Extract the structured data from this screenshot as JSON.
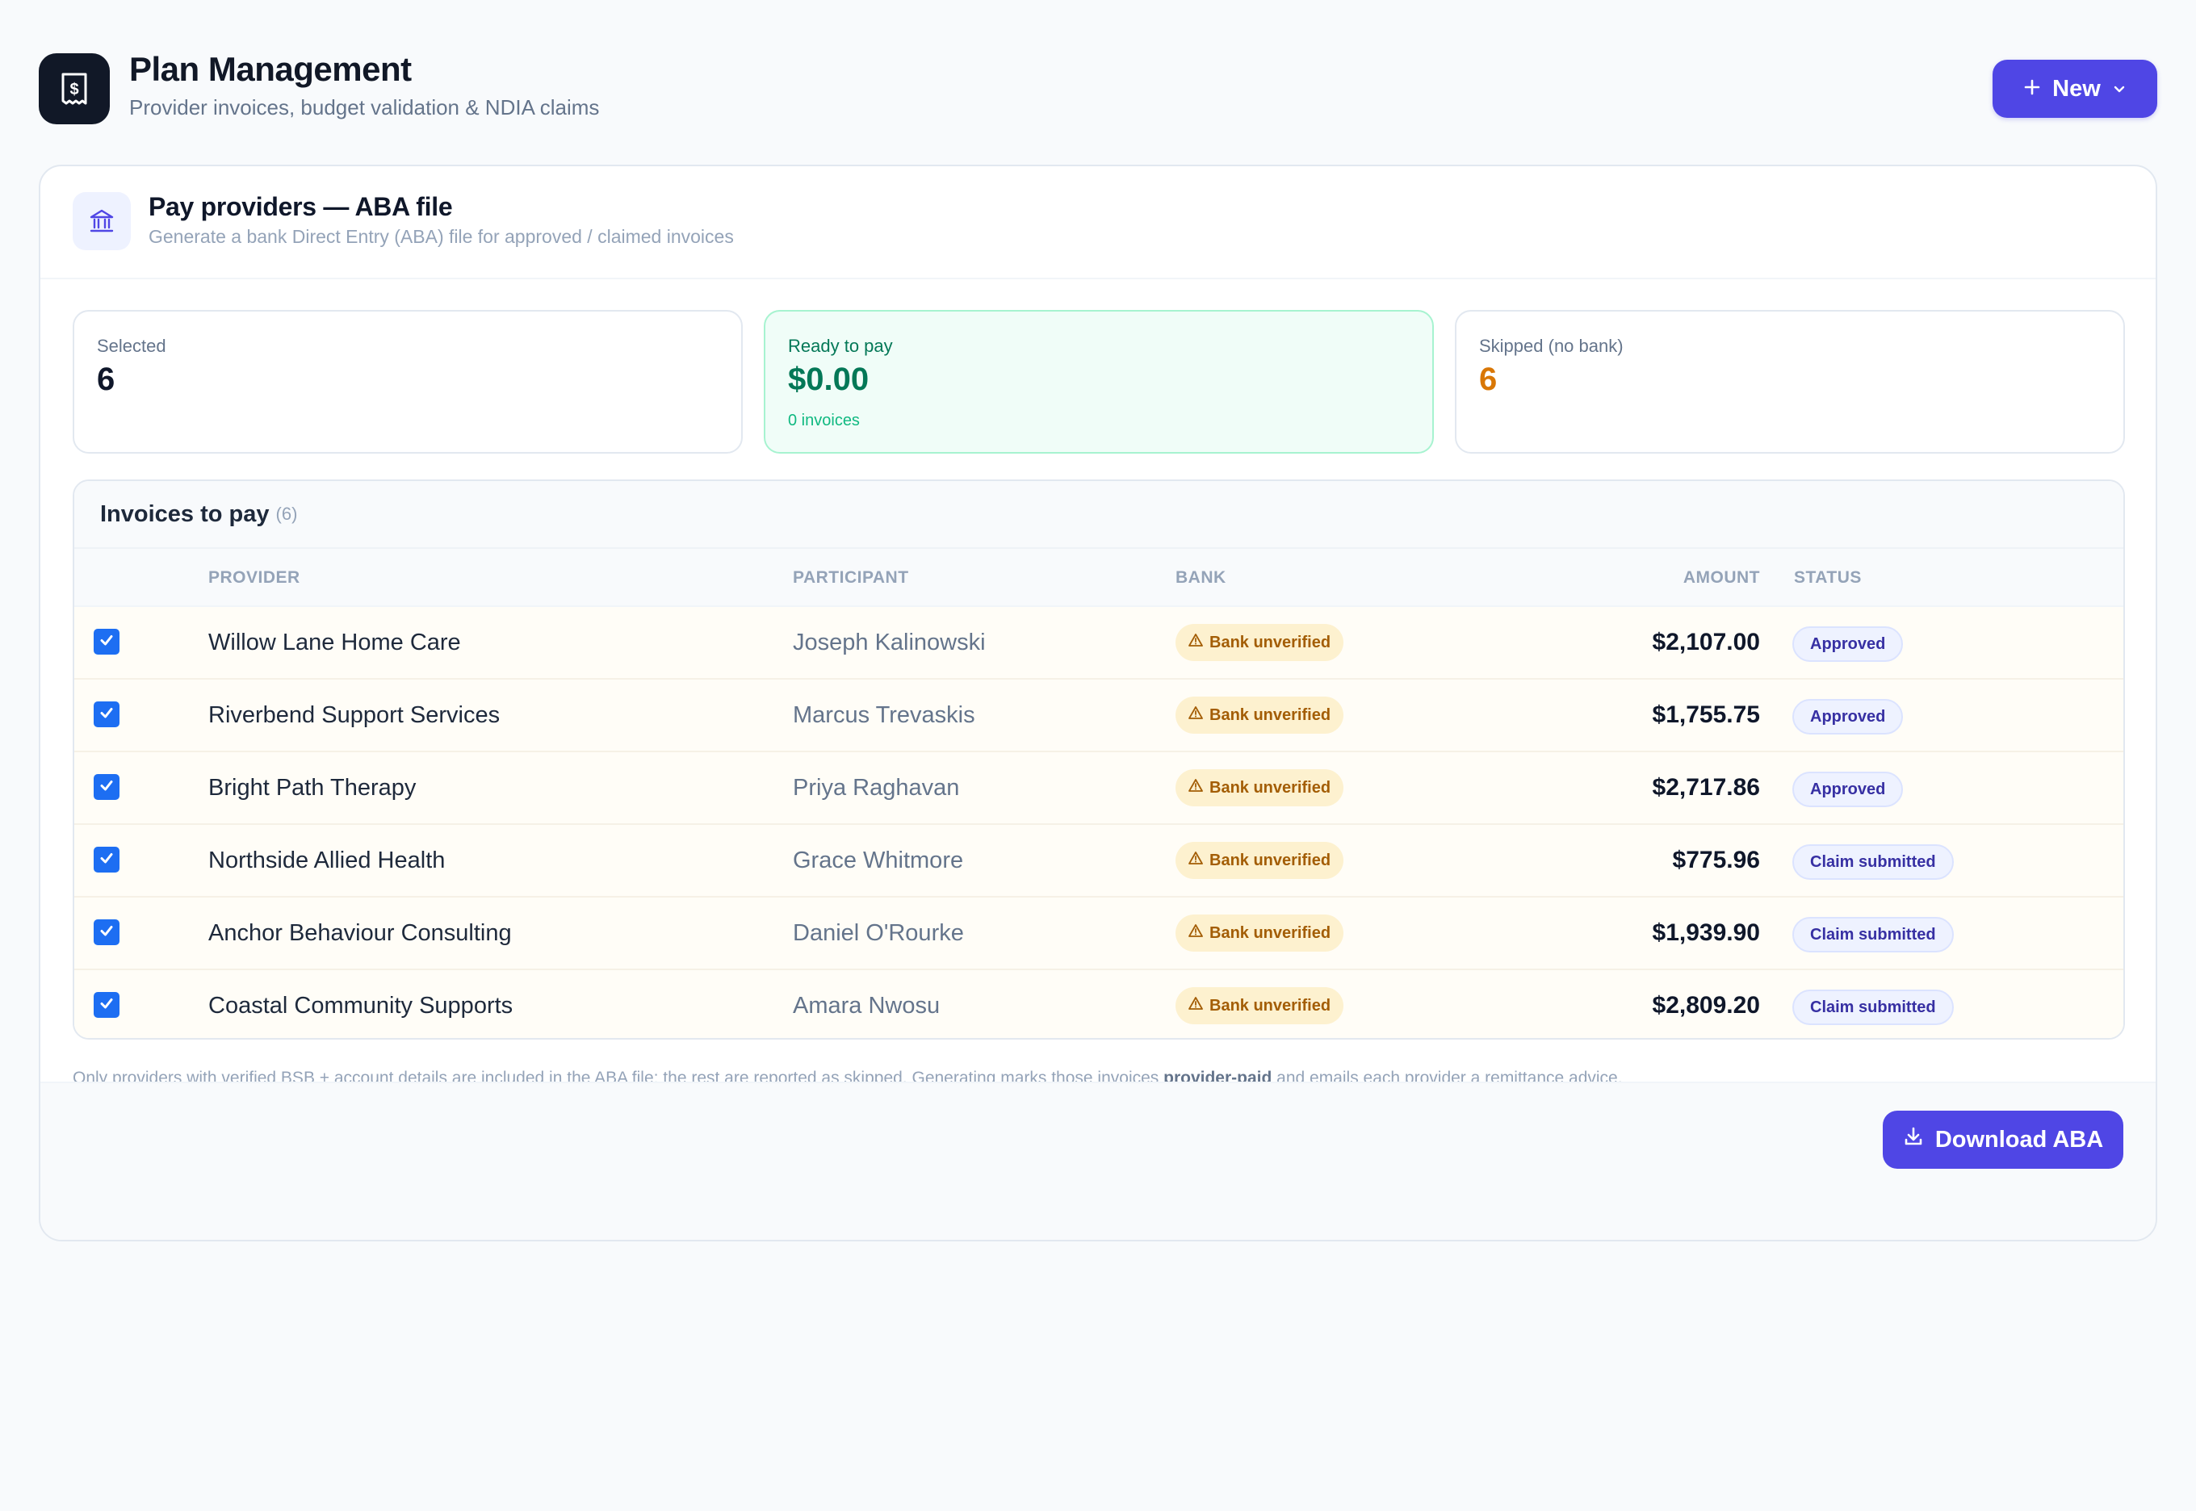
{
  "header": {
    "title": "Plan Management",
    "subtitle": "Provider invoices, budget validation & NDIA claims",
    "new_label": "New"
  },
  "card": {
    "title": "Pay providers — ABA file",
    "subtitle": "Generate a bank Direct Entry (ABA) file for approved / claimed invoices"
  },
  "stats": {
    "selected_label": "Selected",
    "selected_value": "6",
    "ready_label": "Ready to pay",
    "ready_value": "$0.00",
    "ready_sub": "0 invoices",
    "skipped_label": "Skipped (no bank)",
    "skipped_value": "6"
  },
  "invoices": {
    "title": "Invoices to pay",
    "count": "(6)",
    "columns": {
      "provider": "PROVIDER",
      "participant": "PARTICIPANT",
      "bank": "BANK",
      "amount": "AMOUNT",
      "status": "STATUS"
    },
    "rows": [
      {
        "provider": "Willow Lane Home Care",
        "participant": "Joseph Kalinowski",
        "bank": "Bank unverified",
        "amount": "$2,107.00",
        "status": "Approved",
        "checked": true
      },
      {
        "provider": "Riverbend Support Services",
        "participant": "Marcus Trevaskis",
        "bank": "Bank unverified",
        "amount": "$1,755.75",
        "status": "Approved",
        "checked": true
      },
      {
        "provider": "Bright Path Therapy",
        "participant": "Priya Raghavan",
        "bank": "Bank unverified",
        "amount": "$2,717.86",
        "status": "Approved",
        "checked": true
      },
      {
        "provider": "Northside Allied Health",
        "participant": "Grace Whitmore",
        "bank": "Bank unverified",
        "amount": "$775.96",
        "status": "Claim submitted",
        "checked": true
      },
      {
        "provider": "Anchor Behaviour Consulting",
        "participant": "Daniel O'Rourke",
        "bank": "Bank unverified",
        "amount": "$1,939.90",
        "status": "Claim submitted",
        "checked": true
      },
      {
        "provider": "Coastal Community Supports",
        "participant": "Amara Nwosu",
        "bank": "Bank unverified",
        "amount": "$2,809.20",
        "status": "Claim submitted",
        "checked": true
      }
    ]
  },
  "footnote": {
    "before": "Only providers with verified BSB + account details are included in the ABA file; the rest are reported as skipped. Generating marks those invoices ",
    "bold": "provider-paid",
    "after": " and emails each provider a remittance advice."
  },
  "actions": {
    "download_label": "Download ABA"
  },
  "icons": {
    "app_logo": "receipt-dollar-icon",
    "new_plus": "plus-icon",
    "new_chevron": "chevron-down-icon",
    "bank": "bank-icon",
    "warning": "warning-triangle-icon",
    "checkbox": "check-icon",
    "download": "download-icon"
  },
  "colors": {
    "accent": "#4f46e5",
    "success": "#047857",
    "warning": "#d97706",
    "checkbox": "#1d6ef2"
  }
}
